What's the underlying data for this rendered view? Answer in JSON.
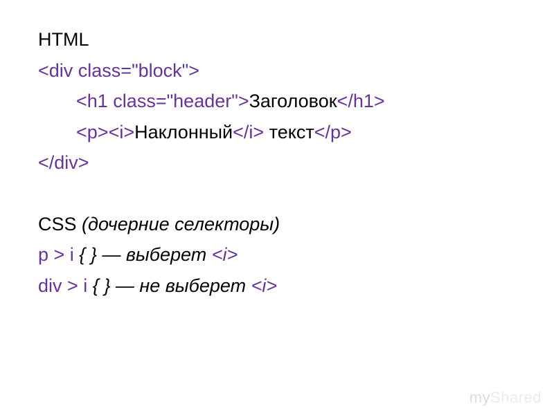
{
  "line1": "HTML",
  "line2_tag": "<div class=\"block\">",
  "line3_open": "<h1 class=\"header\">",
  "line3_text": "Заголовок",
  "line3_close": "</h1>",
  "line4_open1": "<p>",
  "line4_open2": "<i>",
  "line4_text1": "Наклонный",
  "line4_close1": "</i>",
  "line4_text2": " текст",
  "line4_close2": "</p>",
  "line5_tag": "</div>",
  "line6_label": "CSS ",
  "line6_desc": "(дочерние селекторы)",
  "line7_sel": "p > i ",
  "line7_rest": "{ } — выберет ",
  "line7_tag": "<i>",
  "line8_sel": "div > i ",
  "line8_rest": "{ } — не выберет ",
  "line8_tag": "<i>",
  "watermark_my": "my",
  "watermark_shared": "Shared"
}
